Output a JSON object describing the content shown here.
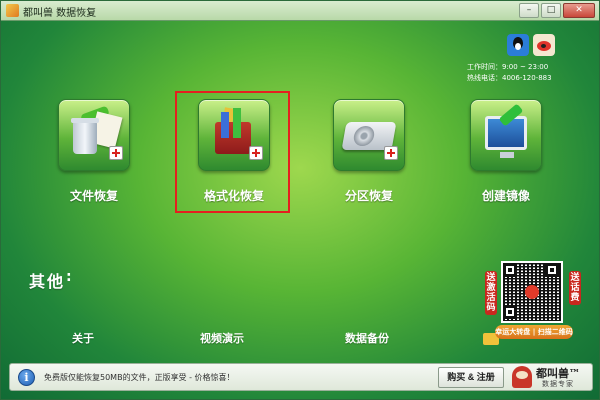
{
  "window": {
    "title": "都叫兽 数据恢复"
  },
  "window_controls": {
    "minimize": "–",
    "maximize": "□",
    "close": "✕"
  },
  "contact": {
    "hours": "工作时间：9:00 ~ 23:00",
    "phone": "热线电话：4006-120-883"
  },
  "social_icons": [
    "qq-icon",
    "weibo-icon"
  ],
  "features": [
    {
      "label": "文件恢复",
      "icon": "file-recovery-icon"
    },
    {
      "label": "格式化恢复",
      "icon": "format-recovery-icon",
      "selected": true
    },
    {
      "label": "分区恢复",
      "icon": "partition-recovery-icon"
    },
    {
      "label": "创建镜像",
      "icon": "create-image-icon"
    }
  ],
  "others": {
    "label": "其他",
    "colon": ":",
    "links": [
      "关于",
      "视频演示",
      "数据备份"
    ]
  },
  "promo": {
    "left_text": "送激活码",
    "right_text": "送话费",
    "ribbon": "幸运大转盘 | 扫描二维码"
  },
  "bottom": {
    "notice": "免费版仅能恢复50MB的文件，正版享受 - 价格惊喜！",
    "buy_button": "购买 & 注册",
    "brand_name": "都叫兽™",
    "brand_sub": "数据专家"
  },
  "colors": {
    "accent_green": "#58b535",
    "selection_red": "#e51f1f",
    "bottom_bar": "#f5f8f3"
  }
}
